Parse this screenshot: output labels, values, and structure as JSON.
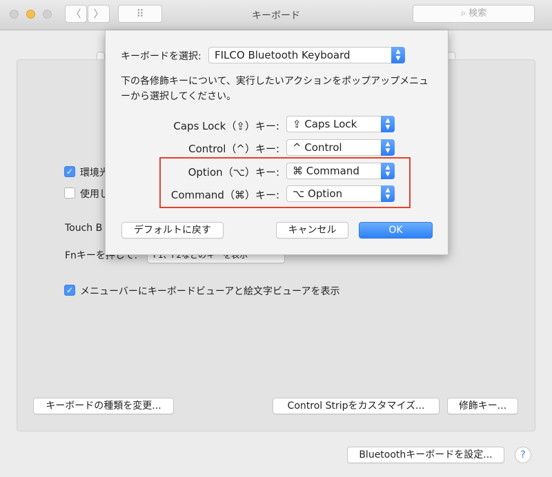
{
  "window": {
    "title": "キーボード",
    "search_placeholder": "検索",
    "back": "〈",
    "forward": "〉",
    "grid": "⠿"
  },
  "background": {
    "checkbox1": {
      "label": "環境光",
      "checked": true
    },
    "checkbox2": {
      "label": "使用し",
      "checked": false
    },
    "touchbar_label": "Touch B",
    "fn_label": "Fnキーを押して:",
    "fn_value": "F1、F2などのキーを表示",
    "checkbox3": {
      "label": "メニューバーにキーボードビューアと絵文字ビューアを表示",
      "checked": true
    },
    "buttons": {
      "change_type": "キーボードの種類を変更...",
      "control_strip": "Control Stripをカスタマイズ...",
      "modifier": "修飾キー...",
      "bluetooth": "Bluetoothキーボードを設定..."
    },
    "help": "?"
  },
  "dialog": {
    "keyboard_label": "キーボードを選択:",
    "keyboard_value": "FILCO Bluetooth Keyboard",
    "description": "下の各修飾キーについて、実行したいアクションをポップアップメニューから選択してください。",
    "rows": [
      {
        "label": "Caps Lock（⇪）キー:",
        "value": "⇪ Caps Lock"
      },
      {
        "label": "Control（^）キー:",
        "value": "^ Control"
      },
      {
        "label": "Option（⌥）キー:",
        "value": "⌘ Command"
      },
      {
        "label": "Command（⌘）キー:",
        "value": "⌥ Option"
      }
    ],
    "highlight_color": "#e8402a",
    "restore_defaults": "デフォルトに戻す",
    "cancel": "キャンセル",
    "ok": "OK"
  }
}
